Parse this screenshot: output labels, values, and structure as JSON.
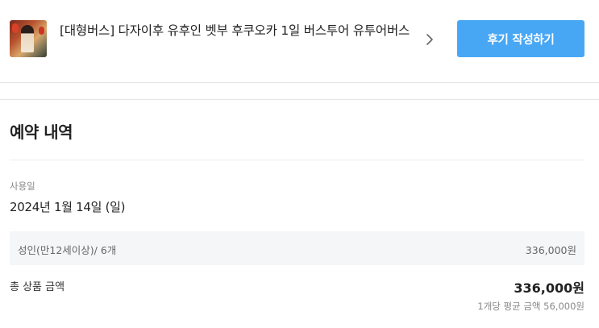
{
  "product": {
    "title": "[대형버스] 다자이후 유후인 벳부 후쿠오카 1일 버스투어 유투어버스",
    "thumbnail_icon": "tour-photo-thumbnail",
    "chevron_icon": "chevron-right-icon",
    "review_button_label": "후기 작성하기"
  },
  "reservation": {
    "section_title": "예약 내역",
    "date_label": "사용일",
    "date_value": "2024년 1월 14일 (일)",
    "options": [
      {
        "name": "성인(만12세이상)/ 6개",
        "price": "336,000원"
      }
    ],
    "total_label": "총 상품 금액",
    "total_value": "336,000원",
    "avg_note": "1개당 평균 금액 56,000원"
  },
  "colors": {
    "accent": "#48a7f5",
    "option_bg": "#f5f6f7",
    "divider": "#e6e6e6"
  }
}
